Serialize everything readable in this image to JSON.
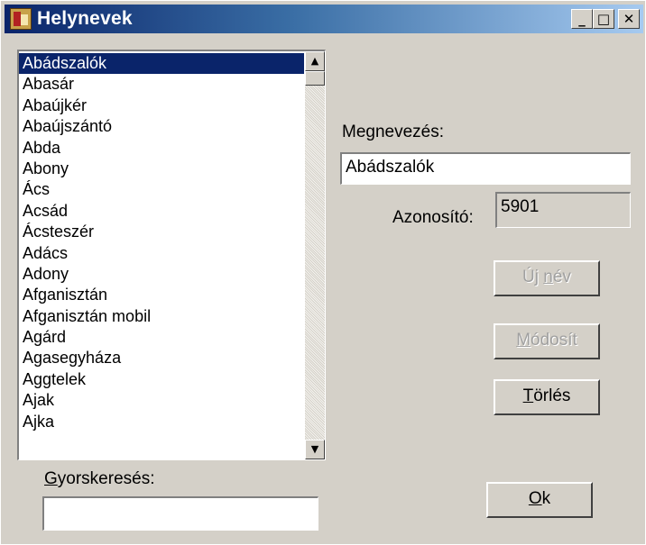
{
  "window": {
    "title": "Helynevek",
    "minimize_glyph": "_",
    "maximize_glyph": "□",
    "close_glyph": "✕"
  },
  "list": {
    "items": [
      "Abádszalók",
      "Abasár",
      "Abaújkér",
      "Abaújszántó",
      "Abda",
      "Abony",
      "Ács",
      "Acsád",
      "Ácsteszér",
      "Adács",
      "Adony",
      "Afganisztán",
      "Afganisztán mobil",
      "Agárd",
      "Agasegyháza",
      "Aggtelek",
      "Ajak",
      "Ajka"
    ],
    "selected_index": 0,
    "scroll_up_glyph": "▲",
    "scroll_down_glyph": "▼"
  },
  "form": {
    "name_label": "Megnevezés:",
    "name_value": "Abádszalók",
    "id_label": "Azonosító:",
    "id_value": "5901"
  },
  "buttons": {
    "new_name": {
      "first": "Új ",
      "accel": "n",
      "rest": "év"
    },
    "modify": {
      "first": "",
      "accel": "M",
      "rest": "ódosít"
    },
    "delete": {
      "first": "",
      "accel": "T",
      "rest": "örlés"
    },
    "ok": {
      "first": "",
      "accel": "O",
      "rest": "k"
    }
  },
  "quick_search": {
    "label_accel": "G",
    "label_rest": "yorskeresés:",
    "value": ""
  },
  "colors": {
    "selection": "#0a246a",
    "window_bg": "#d4d0c8",
    "titlebar_start": "#0a246a",
    "titlebar_end": "#a6caf0"
  }
}
